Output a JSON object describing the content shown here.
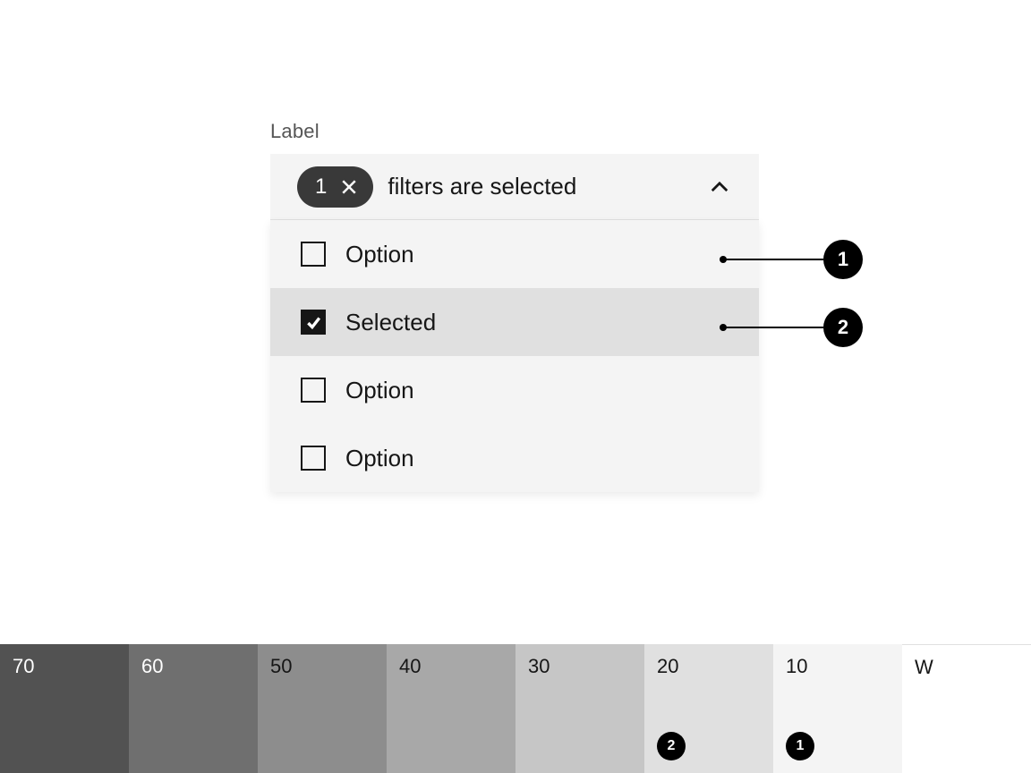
{
  "multiselect": {
    "label": "Label",
    "tag_count": "1",
    "placeholder": "filters are selected",
    "options": [
      {
        "label": "Option",
        "selected": false
      },
      {
        "label": "Selected",
        "selected": true
      },
      {
        "label": "Option",
        "selected": false
      },
      {
        "label": "Option",
        "selected": false
      }
    ]
  },
  "callouts": [
    {
      "n": "1",
      "row_index": 0
    },
    {
      "n": "2",
      "row_index": 1
    }
  ],
  "palette": [
    {
      "label": "70",
      "color": "#525252",
      "text": "#ffffff",
      "badge": null
    },
    {
      "label": "60",
      "color": "#6f6f6f",
      "text": "#ffffff",
      "badge": null
    },
    {
      "label": "50",
      "color": "#8d8d8d",
      "text": "#161616",
      "badge": null
    },
    {
      "label": "40",
      "color": "#a8a8a8",
      "text": "#161616",
      "badge": null
    },
    {
      "label": "30",
      "color": "#c6c6c6",
      "text": "#161616",
      "badge": null
    },
    {
      "label": "20",
      "color": "#e0e0e0",
      "text": "#161616",
      "badge": "2"
    },
    {
      "label": "10",
      "color": "#f4f4f4",
      "text": "#161616",
      "badge": "1"
    },
    {
      "label": "W",
      "color": "#ffffff",
      "text": "#161616",
      "badge": null
    }
  ]
}
